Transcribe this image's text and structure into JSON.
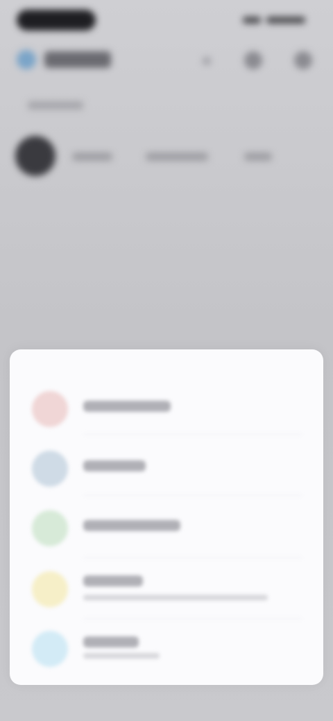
{
  "header": {
    "app_title": "",
    "subtitle": "",
    "meta_a": "",
    "meta_b": "",
    "meta_c": ""
  },
  "sheet": {
    "items": [
      {
        "label": "",
        "sub": "",
        "icon": "red-icon",
        "icon_color": "#f0d6d6"
      },
      {
        "label": "",
        "sub": "",
        "icon": "blue-icon",
        "icon_color": "#cfdbe6"
      },
      {
        "label": "",
        "sub": "",
        "icon": "green-icon",
        "icon_color": "#d7ead8"
      },
      {
        "label": "",
        "sub": "",
        "icon": "yellow-icon",
        "icon_color": "#f6efc8"
      },
      {
        "label": "",
        "sub": "",
        "icon": "light-blue-icon",
        "icon_color": "#d3ebf6"
      }
    ]
  },
  "colors": {
    "background": "#c6c6ca",
    "sheet": "#fbfbfd"
  }
}
